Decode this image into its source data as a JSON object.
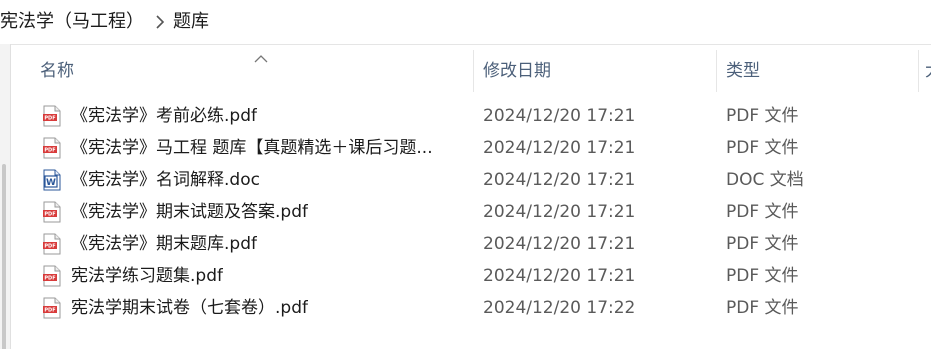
{
  "breadcrumb": {
    "items": [
      "宪法学（马工程）",
      "题库"
    ],
    "separator_icon": "chevron-right-icon"
  },
  "columns": {
    "name": "名称",
    "date": "修改日期",
    "type": "类型",
    "sort_icon": "sort-ascending-icon",
    "more": "大"
  },
  "files": [
    {
      "name": "《宪法学》考前必练.pdf",
      "date": "2024/12/20 17:21",
      "type": "PDF 文件",
      "icon": "pdf-file-icon"
    },
    {
      "name": "《宪法学》马工程 题库【真题精选＋课后习题...",
      "date": "2024/12/20 17:21",
      "type": "PDF 文件",
      "icon": "pdf-file-icon"
    },
    {
      "name": "《宪法学》名词解释.doc",
      "date": "2024/12/20 17:21",
      "type": "DOC 文档",
      "icon": "word-doc-icon"
    },
    {
      "name": "《宪法学》期末试题及答案.pdf",
      "date": "2024/12/20 17:21",
      "type": "PDF 文件",
      "icon": "pdf-file-icon"
    },
    {
      "name": "《宪法学》期末题库.pdf",
      "date": "2024/12/20 17:21",
      "type": "PDF 文件",
      "icon": "pdf-file-icon"
    },
    {
      "name": "宪法学练习题集.pdf",
      "date": "2024/12/20 17:21",
      "type": "PDF 文件",
      "icon": "pdf-file-icon"
    },
    {
      "name": "宪法学期末试卷（七套卷）.pdf",
      "date": "2024/12/20 17:22",
      "type": "PDF 文件",
      "icon": "pdf-file-icon"
    }
  ],
  "colors": {
    "pdf_icon": "#d83b3b",
    "doc_icon": "#2b579a",
    "header_text": "#4c607a"
  }
}
